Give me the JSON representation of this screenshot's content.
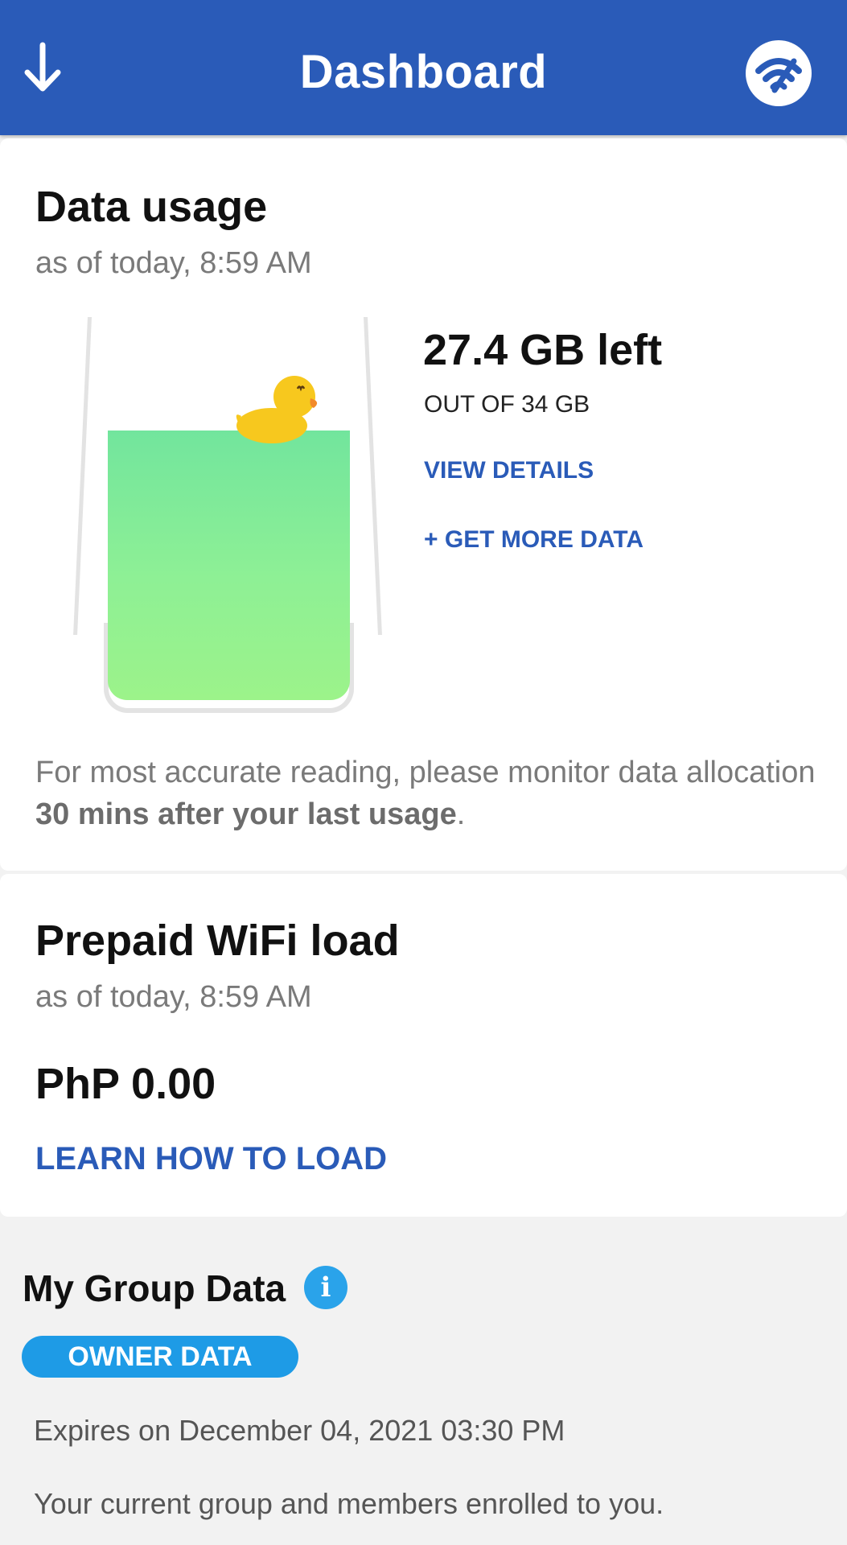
{
  "appbar": {
    "title": "Dashboard",
    "left_icon": "arrow-down-icon",
    "right_icon": "wifi-speed-icon",
    "color": "#2a5bb8"
  },
  "data_usage": {
    "heading": "Data usage",
    "timestamp": "as of today, 8:59 AM",
    "remaining": "27.4 GB left",
    "total": "OUT OF 34 GB",
    "remaining_fraction": 0.806,
    "view_details": "VIEW DETAILS",
    "get_more": "+ GET MORE DATA",
    "note_prefix": "For most accurate reading, please monitor data allocation ",
    "note_bold": "30 mins after your last usage",
    "note_suffix": "."
  },
  "prepaid_load": {
    "heading": "Prepaid WiFi load",
    "timestamp": "as of today, 8:59 AM",
    "amount": "PhP 0.00",
    "learn_link": "LEARN HOW TO LOAD"
  },
  "group_data": {
    "heading": "My Group Data",
    "info_icon": "info-icon",
    "info_glyph": "i",
    "badge": "OWNER DATA",
    "expires": "Expires on December 04, 2021 03:30 PM",
    "description": "Your current group and members enrolled to you."
  },
  "colors": {
    "accent": "#2a5bb8",
    "badge": "#1e9be6",
    "water": "#8ef095"
  }
}
